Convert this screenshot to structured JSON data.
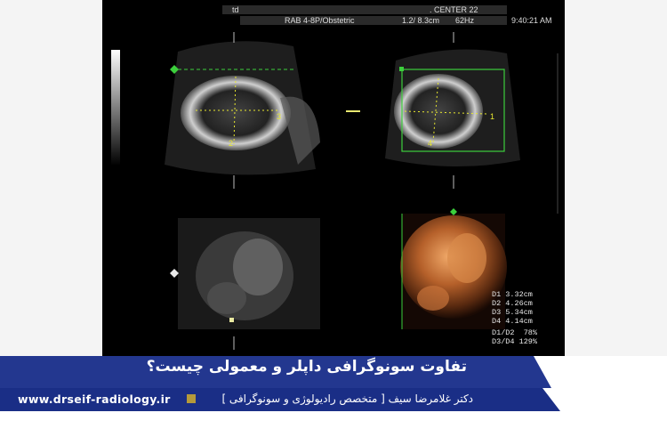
{
  "header": {
    "mode": "td",
    "center": ". CENTER 22",
    "probe": "RAB 4-8P/Obstetric",
    "depth": "1.2/ 8.3cm",
    "framerate": "62Hz",
    "time": "9:40:21 AM"
  },
  "markers": {
    "p1": "1",
    "p2": "2",
    "p3": "3",
    "p4": "4"
  },
  "measurements": [
    "D1 3.32cm",
    "D2 4.26cm",
    "D3 5.34cm",
    "D4 4.14cm",
    "D1/D2  78%",
    "D3/D4 129%"
  ],
  "title": "تفاوت سونوگرافی داپلر و معمولی چیست؟",
  "footer": {
    "url": "www.drseif-radiology.ir",
    "name": "دکتر غلامرضا سیف [ متخصص رادیولوژی و سونوگرافی ]"
  },
  "colors": {
    "banner": "#23378f",
    "footer": "#1a2e86",
    "accent": "#b59a3a",
    "roi": "#3ccf3c",
    "caliper": "#e8e830"
  }
}
